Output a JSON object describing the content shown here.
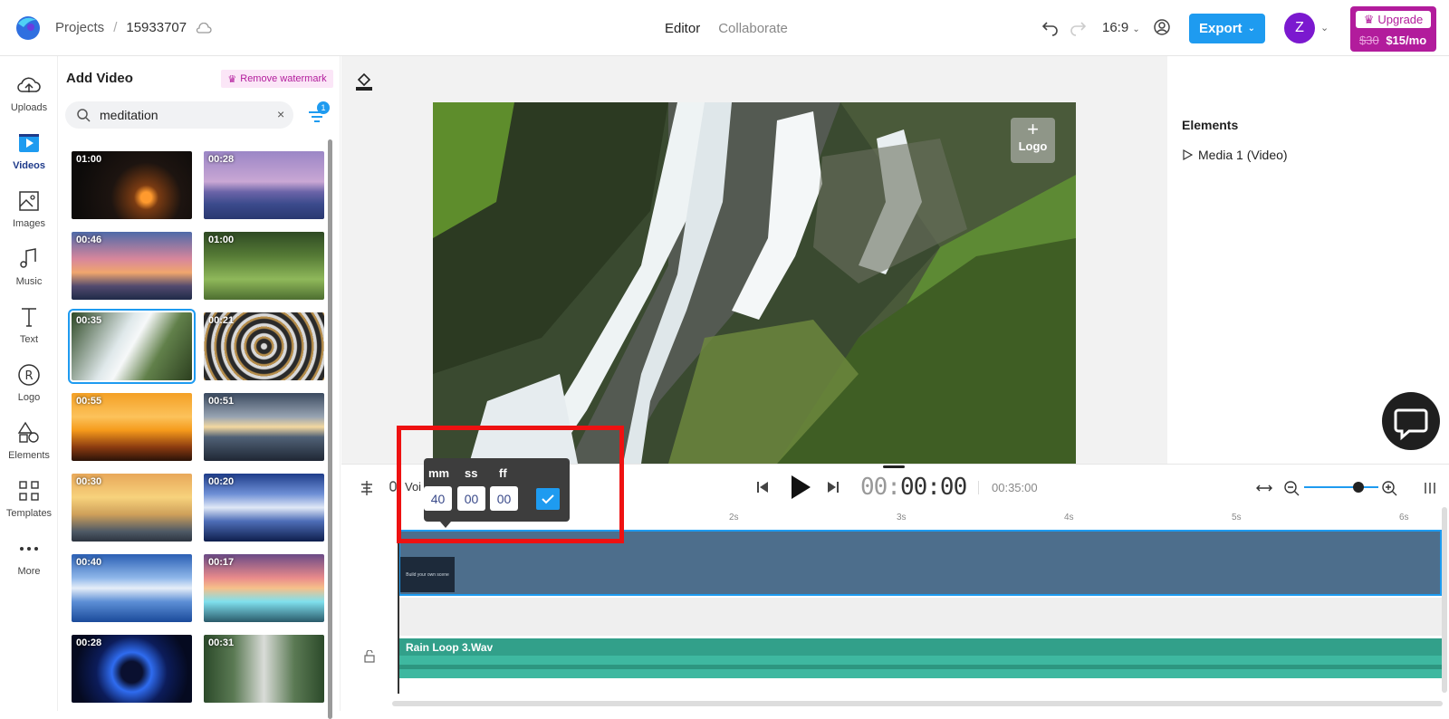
{
  "header": {
    "breadcrumb_root": "Projects",
    "breadcrumb_sep": "/",
    "project_id": "15933707",
    "tabs": [
      {
        "label": "Editor",
        "active": true
      },
      {
        "label": "Collaborate",
        "active": false
      }
    ],
    "aspect_ratio": "16:9",
    "export_label": "Export",
    "avatar_initial": "Z",
    "upgrade_label": "Upgrade",
    "upgrade_old_price": "$30",
    "upgrade_new_price": "$15/mo"
  },
  "leftnav": {
    "items": [
      {
        "label": "Uploads",
        "icon": "cloud-upload-icon",
        "active": false
      },
      {
        "label": "Videos",
        "icon": "video-play-icon",
        "active": true
      },
      {
        "label": "Images",
        "icon": "image-icon",
        "active": false
      },
      {
        "label": "Music",
        "icon": "music-note-icon",
        "active": false
      },
      {
        "label": "Text",
        "icon": "text-t-icon",
        "active": false
      },
      {
        "label": "Logo",
        "icon": "registered-r-icon",
        "active": false
      },
      {
        "label": "Elements",
        "icon": "shapes-icon",
        "active": false
      },
      {
        "label": "Templates",
        "icon": "templates-grid-icon",
        "active": false
      },
      {
        "label": "More",
        "icon": "more-dots-icon",
        "active": false
      }
    ]
  },
  "panel": {
    "title": "Add Video",
    "watermark_label": "Remove watermark",
    "search_value": "meditation",
    "search_clear": "×",
    "filter_badge": "1",
    "thumbs": [
      {
        "duration": "01:00",
        "scene": "fireplace",
        "selected": false
      },
      {
        "duration": "00:28",
        "scene": "purple-sunset-sea",
        "selected": false
      },
      {
        "duration": "00:46",
        "scene": "cloudy-dusk",
        "selected": false
      },
      {
        "duration": "01:00",
        "scene": "grass-field",
        "selected": false
      },
      {
        "duration": "00:35",
        "scene": "waterfall",
        "selected": true
      },
      {
        "duration": "00:21",
        "scene": "metal-circles",
        "selected": false
      },
      {
        "duration": "00:55",
        "scene": "orange-sunset",
        "selected": false
      },
      {
        "duration": "00:51",
        "scene": "ocean-clouds",
        "selected": false
      },
      {
        "duration": "00:30",
        "scene": "golden-beach",
        "selected": false
      },
      {
        "duration": "00:20",
        "scene": "stacked-stones",
        "selected": false
      },
      {
        "duration": "00:40",
        "scene": "blue-sky-figure",
        "selected": false
      },
      {
        "duration": "00:17",
        "scene": "falls-sunset",
        "selected": false
      },
      {
        "duration": "00:28",
        "scene": "blue-portal",
        "selected": false
      },
      {
        "duration": "00:31",
        "scene": "forest-stream",
        "selected": false
      }
    ]
  },
  "canvas": {
    "logo_slot_label": "Logo",
    "logo_slot_plus": "+"
  },
  "elements_panel": {
    "title": "Elements",
    "items": [
      {
        "label": "Media 1 (Video)"
      }
    ]
  },
  "timeline": {
    "voice_label": "Voi",
    "timecode": {
      "mm": "00:",
      "ss": "00",
      "ff": ":00"
    },
    "duration": "00:35:00",
    "ruler_ticks": [
      "2s",
      "3s",
      "4s",
      "5s",
      "6s"
    ],
    "video_clip_text": "Build your own scene",
    "audio_track_name": "Rain Loop 3.Wav"
  },
  "time_popover": {
    "labels": {
      "mm": "mm",
      "ss": "ss",
      "ff": "ff"
    },
    "values": {
      "mm": "40",
      "ss": "00",
      "ff": "00"
    }
  },
  "colors": {
    "accent": "#1e9bf0",
    "upgrade": "#b21c9c",
    "avatar": "#7b19cf",
    "video_track": "#4d6e8c",
    "audio_track": "#3eb8a0",
    "highlight": "#ee1111"
  }
}
